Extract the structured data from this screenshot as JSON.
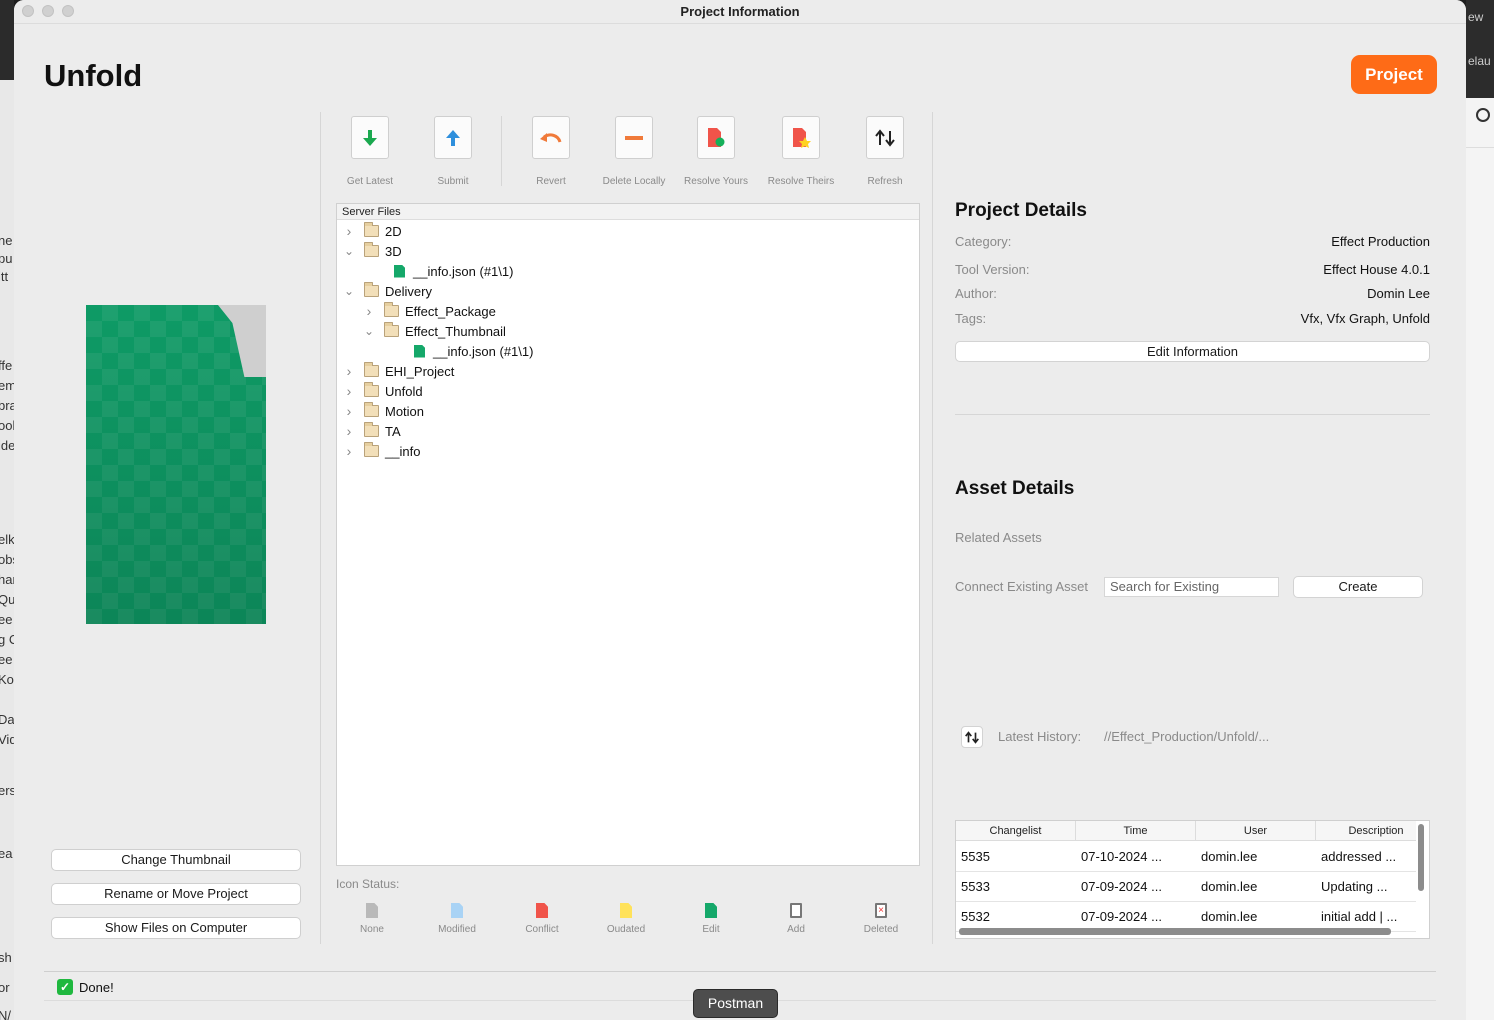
{
  "window": {
    "title": "Project Information"
  },
  "header": {
    "app_title": "Unfold",
    "project_button": "Project"
  },
  "left": {
    "buttons": [
      "Change Thumbnail",
      "Rename or Move Project",
      "Show Files on Computer"
    ]
  },
  "toolbar": [
    {
      "label": "Get Latest",
      "icon": "download-arrow-icon"
    },
    {
      "label": "Submit",
      "icon": "upload-arrow-icon"
    },
    {
      "label": "Revert",
      "icon": "revert-icon"
    },
    {
      "label": "Delete Locally",
      "icon": "minus-icon"
    },
    {
      "label": "Resolve Yours",
      "icon": "resolve-yours-icon"
    },
    {
      "label": "Resolve Theirs",
      "icon": "resolve-theirs-icon"
    },
    {
      "label": "Refresh",
      "icon": "refresh-icon"
    }
  ],
  "tree": {
    "header": "Server Files",
    "nodes": [
      {
        "label": "2D",
        "type": "folder",
        "state": "collapsed"
      },
      {
        "label": "3D",
        "type": "folder",
        "state": "expanded"
      },
      {
        "label": "__info.json (#1\\1)",
        "type": "file"
      },
      {
        "label": "Delivery",
        "type": "folder",
        "state": "expanded"
      },
      {
        "label": "Effect_Package",
        "type": "folder",
        "state": "collapsed"
      },
      {
        "label": "Effect_Thumbnail",
        "type": "folder",
        "state": "expanded"
      },
      {
        "label": "__info.json (#1\\1)",
        "type": "file"
      },
      {
        "label": "EHI_Project",
        "type": "folder",
        "state": "collapsed"
      },
      {
        "label": "Unfold",
        "type": "folder",
        "state": "collapsed"
      },
      {
        "label": "Motion",
        "type": "folder",
        "state": "collapsed"
      },
      {
        "label": "TA",
        "type": "folder",
        "state": "collapsed"
      },
      {
        "label": "__info",
        "type": "folder",
        "state": "collapsed"
      }
    ]
  },
  "icon_status": {
    "label": "Icon Status:",
    "items": [
      {
        "label": "None",
        "color": "#b9b9b9"
      },
      {
        "label": "Modified",
        "color": "#a9d3f5"
      },
      {
        "label": "Conflict",
        "color": "#f0544a"
      },
      {
        "label": "Oudated",
        "color": "#ffe25a"
      },
      {
        "label": "Edit",
        "color": "#15a86a"
      },
      {
        "label": "Add",
        "color": "#ffffff"
      },
      {
        "label": "Deleted",
        "color": "#ffffff"
      }
    ]
  },
  "project_details": {
    "title": "Project Details",
    "rows": [
      {
        "key": "Category:",
        "value": "Effect Production"
      },
      {
        "key": "Tool Version:",
        "value": "Effect House 4.0.1"
      },
      {
        "key": "Author:",
        "value": "Domin Lee"
      },
      {
        "key": "Tags:",
        "value": "Vfx,  Vfx Graph, Unfold"
      }
    ],
    "edit_button": "Edit Information"
  },
  "asset_details": {
    "title": "Asset Details",
    "related_label": "Related Assets",
    "connect_label": "Connect Existing Asset",
    "search_placeholder": "Search for Existing",
    "create_button": "Create"
  },
  "history": {
    "label": "Latest History:",
    "path": "//Effect_Production/Unfold/...",
    "columns": [
      "Changelist",
      "Time",
      "User",
      "Description"
    ],
    "rows": [
      [
        "5535",
        "07-10-2024 ...",
        "domin.lee",
        "addressed ..."
      ],
      [
        "5533",
        "07-09-2024 ...",
        "domin.lee",
        "Updating ..."
      ],
      [
        "5532",
        "07-09-2024 ...",
        "domin.lee",
        "initial add | ..."
      ]
    ]
  },
  "status_bar": {
    "text": "Done!"
  },
  "tooltip": {
    "text": "Postman"
  },
  "background_fragments": {
    "left": [
      "ne",
      "pu",
      "itt",
      "ffe",
      "em",
      "bra",
      "ool",
      "ide",
      "elk",
      "obs",
      "har",
      "Qu",
      "ee",
      "g C",
      "ee",
      "Ko",
      "Dah",
      "Vid",
      "ers",
      "ea",
      "sh",
      "or",
      "N/"
    ],
    "right": [
      "ew",
      "elau"
    ]
  },
  "colors": {
    "accent": "#fe6b17",
    "edit_green": "#15a86a"
  }
}
